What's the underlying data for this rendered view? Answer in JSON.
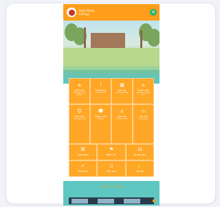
{
  "site": {
    "brand_line1": "Bach Dang",
    "brand_line2": "College"
  },
  "menu_icon": "menu-icon",
  "colors": {
    "topbar": "#ff9e1b",
    "tile": "#ffa726",
    "band": "#5fc7c2",
    "menu_button": "#2db36b"
  },
  "tiles_row1": [
    {
      "icon": "bank-icon",
      "glyph": "🏛",
      "label": "Giới thiệu",
      "sub": "Tổng quan về trường"
    },
    {
      "icon": "info-icon",
      "glyph": "!",
      "label": "Thông báo",
      "sub": "Tin tức mới"
    },
    {
      "icon": "calendar-icon",
      "glyph": "▦",
      "label": "Lịch học",
      "sub": "Thời khóa biểu"
    },
    {
      "icon": "school-icon",
      "glyph": "⌂",
      "label": "Tuyển sinh",
      "sub": "Thông tin tuyển sinh"
    }
  ],
  "tiles_row2": [
    {
      "icon": "people-icon",
      "glyph": "👥",
      "label": "Sinh viên",
      "sub": "Góc sinh viên"
    },
    {
      "icon": "group-icon",
      "glyph": "👪",
      "label": "Giảng viên",
      "sub": "Đội ngũ"
    },
    {
      "icon": "home-icon",
      "glyph": "🏠",
      "label": "Đào tạo",
      "sub": "Chương trình"
    },
    {
      "icon": "card-icon",
      "glyph": "▭",
      "label": "Học phí",
      "sub": "Thông tin"
    }
  ],
  "tiles_row3": [
    {
      "icon": "gift-icon",
      "glyph": "⌘",
      "label": "Hoạt động"
    },
    {
      "icon": "flag-icon",
      "glyph": "⚑",
      "label": "Đoàn hội"
    },
    {
      "icon": "bus-icon",
      "glyph": "⊟",
      "label": "Xe đưa đón"
    }
  ],
  "tiles_row4": [
    {
      "icon": "thumbs-up-icon",
      "glyph": "👍",
      "label": "Khảo sát"
    },
    {
      "icon": "document-icon",
      "glyph": "▯",
      "label": "Văn bản"
    },
    {
      "icon": "handshake-icon",
      "glyph": "✋",
      "label": "Hợp tác"
    }
  ],
  "bottom": {
    "title": "Hình ảnh hoạt động"
  }
}
